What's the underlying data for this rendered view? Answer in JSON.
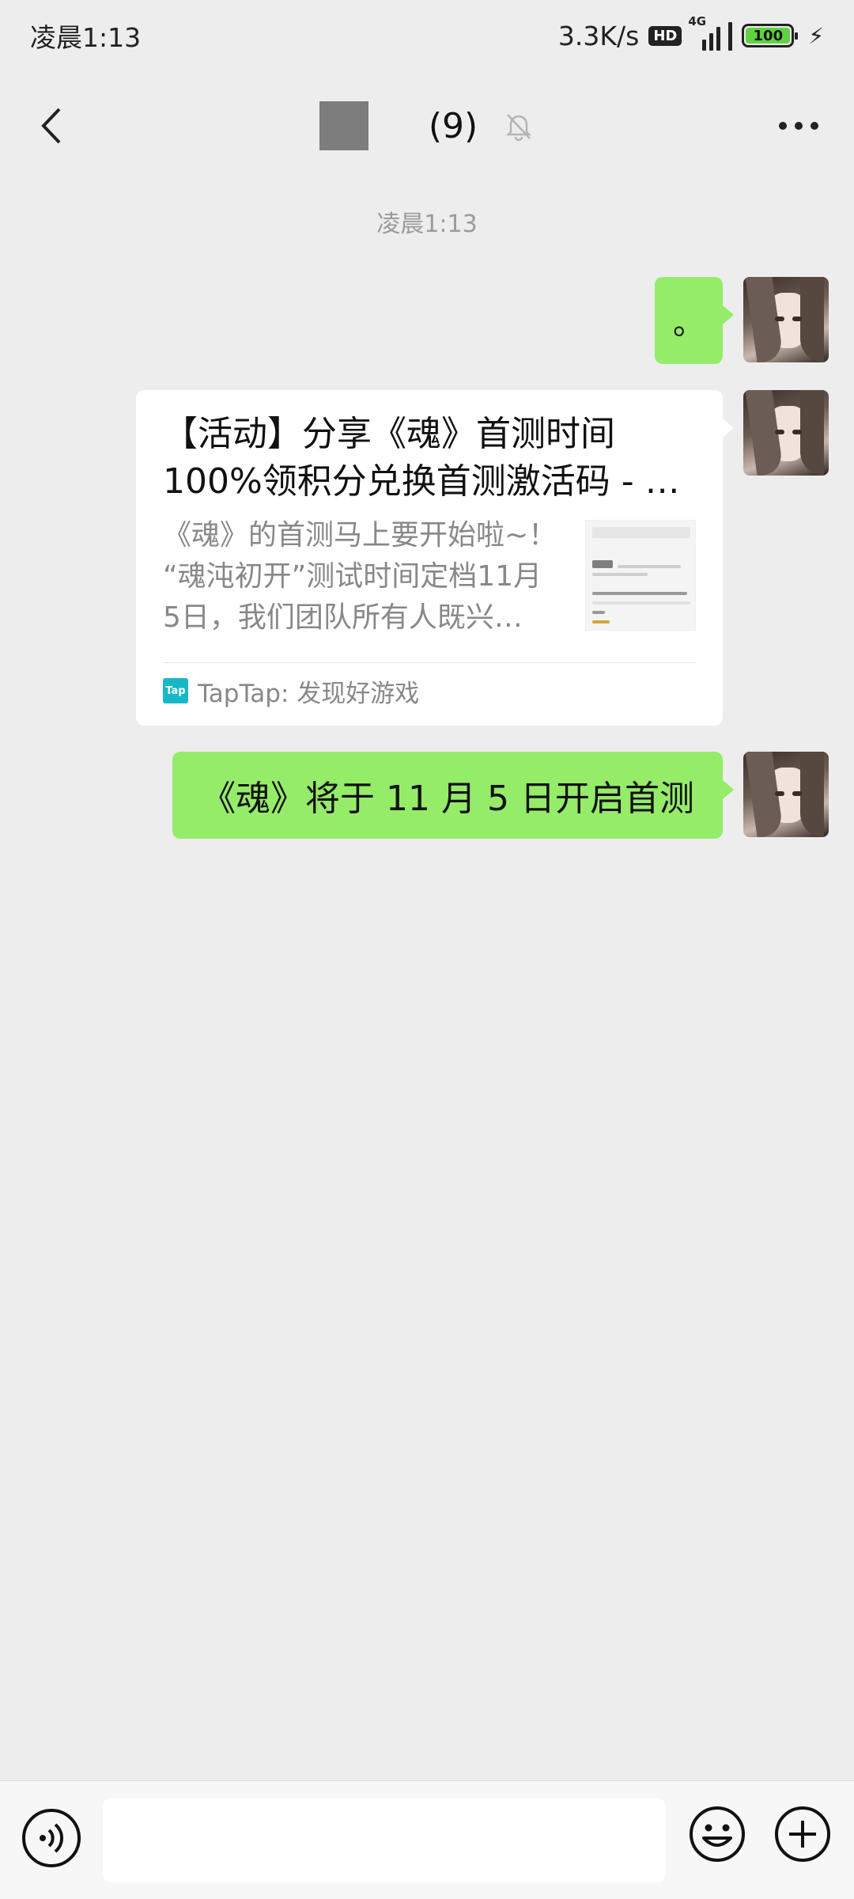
{
  "status_bar": {
    "time": "凌晨1:13",
    "net_speed": "3.3K/s",
    "hd": "HD",
    "network": "4G",
    "battery": "100"
  },
  "header": {
    "title": "(9)",
    "icons": [
      "back-arrow-icon",
      "mute-bell-icon",
      "more-icon"
    ]
  },
  "chat": {
    "timestamp": "凌晨1:13",
    "messages": [
      {
        "type": "text",
        "text": "。"
      },
      {
        "type": "link",
        "title_line1": "【活动】分享《魂》首测时间",
        "title_line2": "100%领积分兑换首测激活码 - …",
        "desc_line1": "《魂》的首测马上要开始啦~！",
        "desc_line2": "“魂沌初开”测试时间定档11月",
        "desc_line3": "5日，我们团队所有人既兴…",
        "source": "TapTap: 发现好游戏",
        "source_logo": "Tap"
      },
      {
        "type": "text",
        "text": "《魂》将于 11 月 5 日开启首测"
      }
    ]
  },
  "colors": {
    "background": "#ededed",
    "bubble_green": "#95ec69",
    "card_white": "#ffffff",
    "tap_brand": "#16b8c8"
  }
}
